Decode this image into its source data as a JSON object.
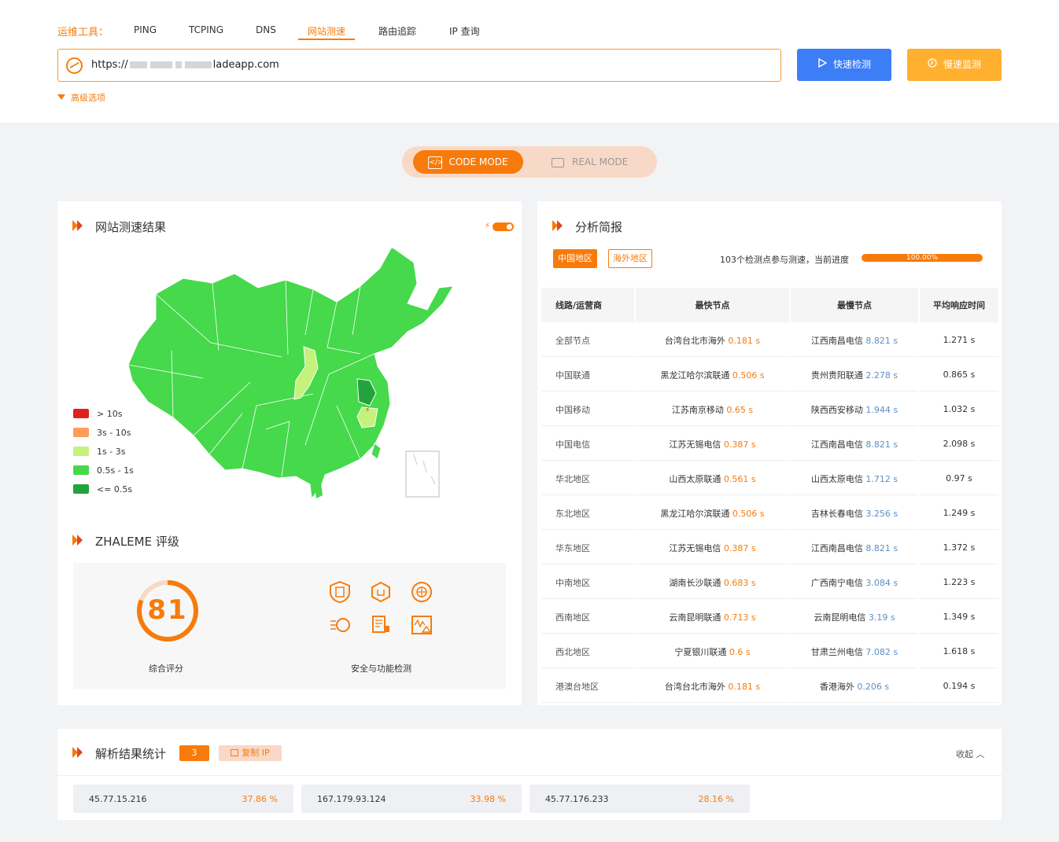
{
  "nav": {
    "label": "运维工具：",
    "tabs": [
      "PING",
      "TCPING",
      "DNS",
      "网站测速",
      "路由追踪",
      "IP 查询"
    ],
    "active": 3
  },
  "url": {
    "prefix": "https://",
    "suffix": "ladeapp.com"
  },
  "buttons": {
    "quick": "快速检测",
    "slow": "慢速监测"
  },
  "advanced": "高级选项",
  "mode": {
    "code": "CODE MODE",
    "real": "REAL MODE"
  },
  "result": {
    "title": "网站测速结果",
    "legend": [
      {
        "label": "> 10s",
        "color": "#e02020"
      },
      {
        "label": "3s - 10s",
        "color": "#ff9d5a"
      },
      {
        "label": "1s - 3s",
        "color": "#c4f27a"
      },
      {
        "label": "0.5s - 1s",
        "color": "#45d94b"
      },
      {
        "label": "<= 0.5s",
        "color": "#22a33b"
      }
    ]
  },
  "rating": {
    "title": "ZHALEME 评级",
    "score": "81",
    "score_value": 81,
    "score_label": "综合评分",
    "security_label": "安全与功能检测"
  },
  "analysis": {
    "title": "分析简报",
    "tab_cn": "中国地区",
    "tab_overseas": "海外地区",
    "progress_text": "103个检测点参与测速，当前进度",
    "progress": "100.00%",
    "columns": [
      "线路/运营商",
      "最快节点",
      "最慢节点",
      "平均响应时间"
    ],
    "rows": [
      {
        "name": "全部节点",
        "fast": "台湾台北市海外",
        "fast_t": "0.181 s",
        "slow": "江西南昌电信",
        "slow_t": "8.821 s",
        "avg": "1.271 s"
      },
      {
        "name": "中国联通",
        "fast": "黑龙江哈尔滨联通",
        "fast_t": "0.506 s",
        "slow": "贵州贵阳联通",
        "slow_t": "2.278 s",
        "avg": "0.865 s"
      },
      {
        "name": "中国移动",
        "fast": "江苏南京移动",
        "fast_t": "0.65 s",
        "slow": "陕西西安移动",
        "slow_t": "1.944 s",
        "avg": "1.032 s"
      },
      {
        "name": "中国电信",
        "fast": "江苏无锡电信",
        "fast_t": "0.387 s",
        "slow": "江西南昌电信",
        "slow_t": "8.821 s",
        "avg": "2.098 s"
      },
      {
        "name": "华北地区",
        "fast": "山西太原联通",
        "fast_t": "0.561 s",
        "slow": "山西太原电信",
        "slow_t": "1.712 s",
        "avg": "0.97 s"
      },
      {
        "name": "东北地区",
        "fast": "黑龙江哈尔滨联通",
        "fast_t": "0.506 s",
        "slow": "吉林长春电信",
        "slow_t": "3.256 s",
        "avg": "1.249 s"
      },
      {
        "name": "华东地区",
        "fast": "江苏无锡电信",
        "fast_t": "0.387 s",
        "slow": "江西南昌电信",
        "slow_t": "8.821 s",
        "avg": "1.372 s"
      },
      {
        "name": "中南地区",
        "fast": "湖南长沙联通",
        "fast_t": "0.683 s",
        "slow": "广西南宁电信",
        "slow_t": "3.084 s",
        "avg": "1.223 s"
      },
      {
        "name": "西南地区",
        "fast": "云南昆明联通",
        "fast_t": "0.713 s",
        "slow": "云南昆明电信",
        "slow_t": "3.19 s",
        "avg": "1.349 s"
      },
      {
        "name": "西北地区",
        "fast": "宁夏银川联通",
        "fast_t": "0.6 s",
        "slow": "甘肃兰州电信",
        "slow_t": "7.082 s",
        "avg": "1.618 s"
      },
      {
        "name": "港澳台地区",
        "fast": "台湾台北市海外",
        "fast_t": "0.181 s",
        "slow": "香港海外",
        "slow_t": "0.206 s",
        "avg": "0.194 s"
      }
    ]
  },
  "resolve": {
    "title": "解析结果统计",
    "count": "3",
    "copy": "复制 IP",
    "fold": "收起",
    "ips": [
      {
        "ip": "45.77.15.216",
        "pct": "37.86 %"
      },
      {
        "ip": "167.179.93.124",
        "pct": "33.98 %"
      },
      {
        "ip": "45.77.176.233",
        "pct": "28.16 %"
      }
    ]
  },
  "colors": {
    "accent": "#f77b0b",
    "blue": "#3c7ef5",
    "yellow": "#ffb02e",
    "map_green": "#45d94b",
    "map_light": "#c4f27a",
    "map_dark": "#22a33b"
  }
}
